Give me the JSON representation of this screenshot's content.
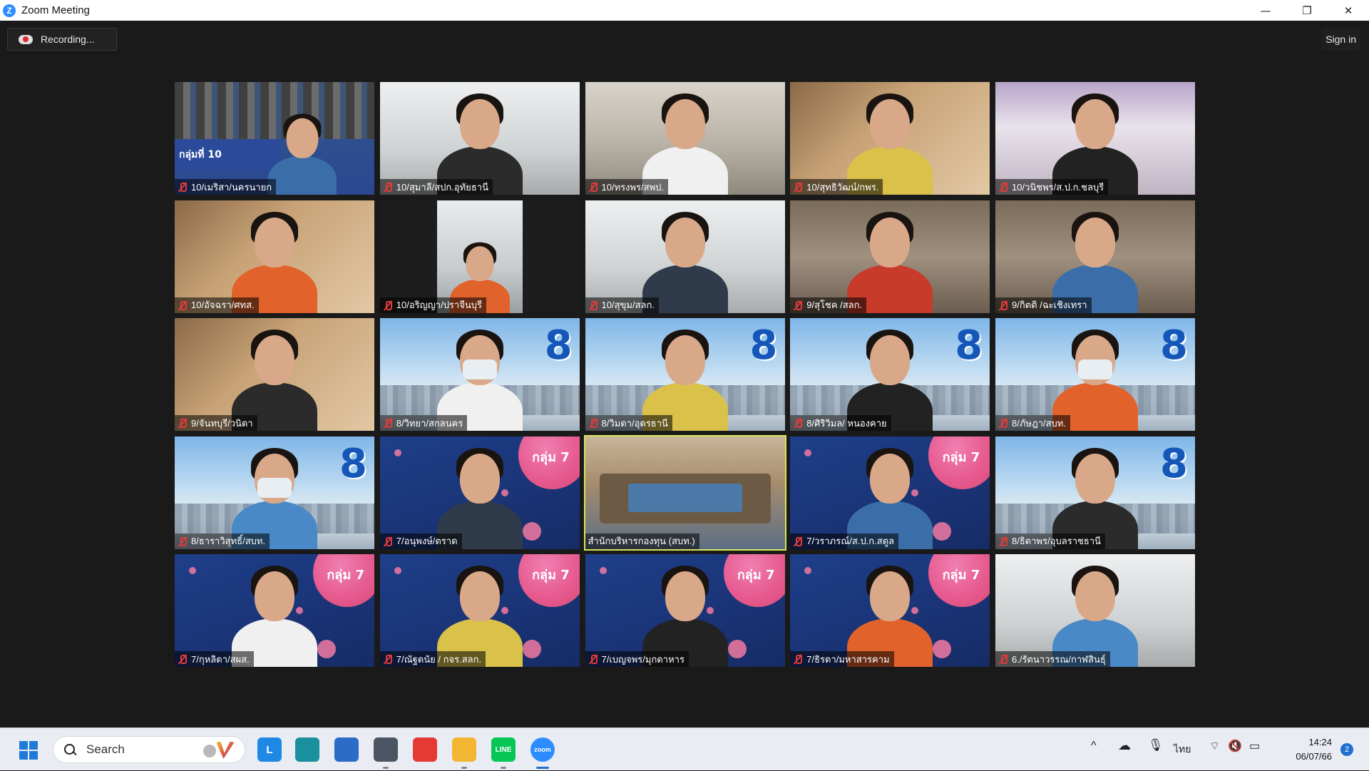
{
  "window": {
    "title": "Zoom Meeting",
    "minimize": "—",
    "restore": "❐",
    "close": "✕"
  },
  "toolbar": {
    "recording_label": "Recording...",
    "signin_label": "Sign in"
  },
  "tiles": [
    {
      "name": "10/เมริสา/นครนายก",
      "bg": "grad10",
      "group_label": "กลุ่มที่ 10"
    },
    {
      "name": "10/สุมาลี/สปก.อุทัยธานี",
      "bg": "bright"
    },
    {
      "name": "10/ทรงพร/สพป.",
      "bg": "office"
    },
    {
      "name": "10/สุทธิวัฒน์/กพร.",
      "bg": "warm"
    },
    {
      "name": "10/วนิชพร/ส.ป.ก.ชลบุรี",
      "bg": "purple"
    },
    {
      "name": "10/อัจฉรา/ศทส.",
      "bg": "warm"
    },
    {
      "name": "10/อริญญา/ปราจีนบุรี",
      "bg": "dark"
    },
    {
      "name": "10/สุขุม/สลก.",
      "bg": "bright"
    },
    {
      "name": "9/สุโชค /สลก.",
      "bg": "room"
    },
    {
      "name": "9/กิตติ /ฉะเชิงเทรา",
      "bg": "room"
    },
    {
      "name": "9/จันทบุรี/วนิดา",
      "bg": "warm"
    },
    {
      "name": "8/วิทยา/สกลนคร",
      "bg": "blue8",
      "mask": true
    },
    {
      "name": "8/วิมดา/อุดรธานี",
      "bg": "blue8"
    },
    {
      "name": "8/ศิริวิมล/ หนองคาย",
      "bg": "blue8"
    },
    {
      "name": "8/ภัษฎา/สบท.",
      "bg": "blue8",
      "mask": true
    },
    {
      "name": "8/ธาราวิสุทธิ์/สบท.",
      "bg": "blue8",
      "mask": true
    },
    {
      "name": "7/อนุพงษ์/ตราด",
      "bg": "group7"
    },
    {
      "name": "สำนักบริหารกองทุน (สบท.)",
      "bg": "meeting",
      "active": true,
      "muted": false
    },
    {
      "name": "7/วราภรณ์/ส.ป.ก.สตูล",
      "bg": "group7"
    },
    {
      "name": "8/ธิดาพร/อุบลราชธานี",
      "bg": "blue8"
    },
    {
      "name": "7/กุหลิดา/สผส.",
      "bg": "group7"
    },
    {
      "name": "7/ณัฐดนัย / กจร.สลก.",
      "bg": "group7"
    },
    {
      "name": "7/เบญจพร/มุกดาหาร",
      "bg": "group7"
    },
    {
      "name": "7/ธิรดา/มหาสารคาม",
      "bg": "group7"
    },
    {
      "name": "6./รัตนาวรรณ/กาฬสินธุ์",
      "bg": "bright"
    }
  ],
  "badges": {
    "eight": "8",
    "seven": "กลุ่ม 7"
  },
  "taskbar": {
    "search_placeholder": "Search",
    "apps": [
      {
        "icon": "l-app-icon",
        "label": "L",
        "color": "#1e88e5"
      },
      {
        "icon": "edge-icon",
        "label": "",
        "color": "#1a8f9e"
      },
      {
        "icon": "store-icon",
        "label": "",
        "color": "#2a6cc8"
      },
      {
        "icon": "calculator-icon",
        "label": "",
        "color": "#4b5563"
      },
      {
        "icon": "chrome-icon",
        "label": "",
        "color": "#e53935"
      },
      {
        "icon": "file-explorer-icon",
        "label": "",
        "color": "#f2b632"
      },
      {
        "icon": "line-icon",
        "label": "LINE",
        "color": "#06c755"
      },
      {
        "icon": "zoom-icon",
        "label": "zoom",
        "color": "#2d8cff"
      }
    ],
    "tray": {
      "chevron": "^",
      "language": "ไทย",
      "time": "14:24",
      "date": "06/07/66",
      "notifications": "2"
    }
  }
}
